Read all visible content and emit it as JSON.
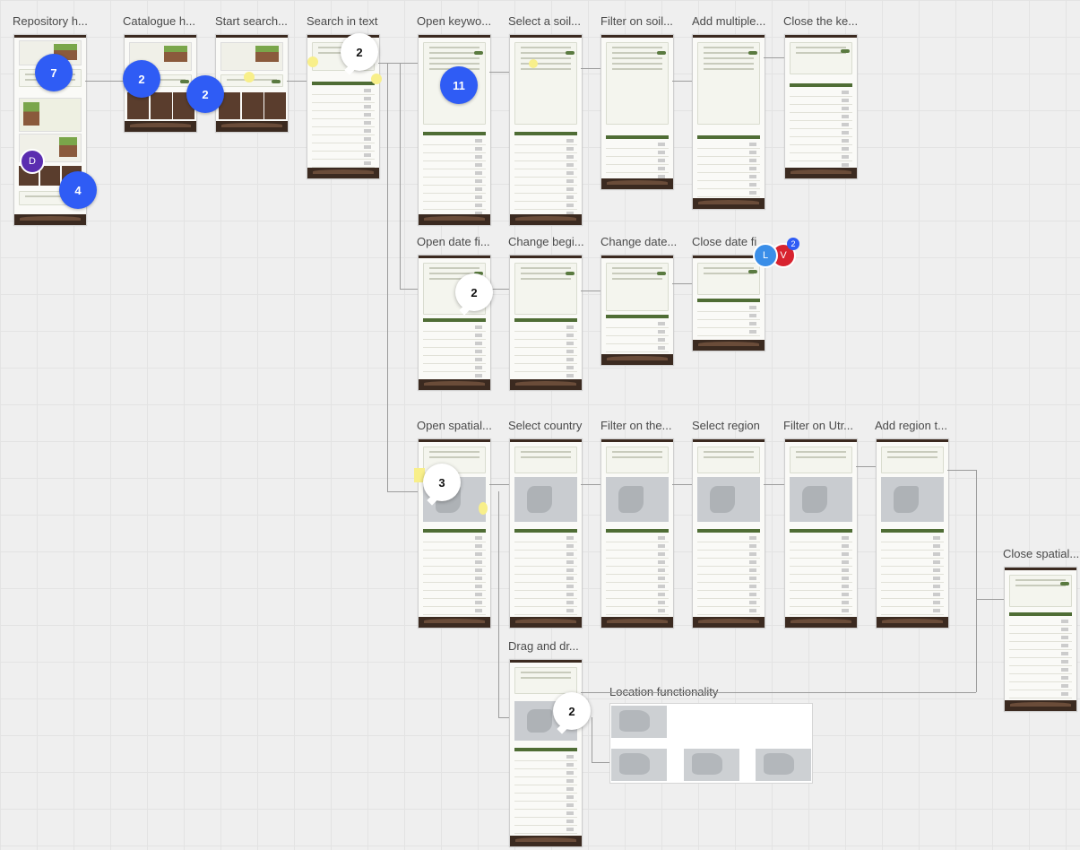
{
  "board": {
    "frames": [
      {
        "id": "repo-home",
        "title": "Repository h...",
        "kind": "home"
      },
      {
        "id": "catalogue-home",
        "title": "Catalogue h...",
        "kind": "catalogue"
      },
      {
        "id": "start-search",
        "title": "Start search...",
        "kind": "catalogue"
      },
      {
        "id": "search-text",
        "title": "Search in text",
        "kind": "list"
      },
      {
        "id": "open-keyword",
        "title": "Open keywo...",
        "kind": "keyword"
      },
      {
        "id": "select-soil",
        "title": "Select a soil...",
        "kind": "keyword"
      },
      {
        "id": "filter-soil",
        "title": "Filter on soil...",
        "kind": "keyword"
      },
      {
        "id": "add-multiple",
        "title": "Add multiple...",
        "kind": "keyword"
      },
      {
        "id": "close-keyword",
        "title": "Close the ke...",
        "kind": "list"
      },
      {
        "id": "open-date",
        "title": "Open date fi...",
        "kind": "date"
      },
      {
        "id": "change-begin",
        "title": "Change begi...",
        "kind": "date"
      },
      {
        "id": "change-date",
        "title": "Change date...",
        "kind": "date"
      },
      {
        "id": "close-date",
        "title": "Close date fi",
        "kind": "list"
      },
      {
        "id": "open-spatial",
        "title": "Open spatial...",
        "kind": "map"
      },
      {
        "id": "select-country",
        "title": "Select country",
        "kind": "map"
      },
      {
        "id": "filter-the",
        "title": "Filter on the...",
        "kind": "map"
      },
      {
        "id": "select-region",
        "title": "Select region",
        "kind": "map"
      },
      {
        "id": "filter-utr",
        "title": "Filter on Utr...",
        "kind": "map"
      },
      {
        "id": "add-region",
        "title": "Add region t...",
        "kind": "map"
      },
      {
        "id": "close-spatial",
        "title": "Close spatial...",
        "kind": "list"
      },
      {
        "id": "drag-drop",
        "title": "Drag and dr...",
        "kind": "map"
      }
    ],
    "location_section_title": "Location functionality",
    "comment_counts": {
      "repo_a": "7",
      "repo_b": "4",
      "catalogue_a": "2",
      "catalogue_b": "2",
      "search_text": "2",
      "open_keyword": "11",
      "open_date": "2",
      "open_spatial": "3",
      "drag_drop": "2"
    },
    "avatars": {
      "repo_user": "D",
      "close_date_user_1": "L",
      "close_date_user_2": "V",
      "close_date_badge": "2"
    },
    "colors": {
      "comment_bubble": "#2f5cf5",
      "header_dark": "#3b2a20",
      "table_header": "#4f6d35",
      "sticky_note": "#f8ef8a",
      "avatar_d": "#5b2db0",
      "avatar_l": "#3a8ee8",
      "avatar_v": "#d8232f"
    }
  }
}
